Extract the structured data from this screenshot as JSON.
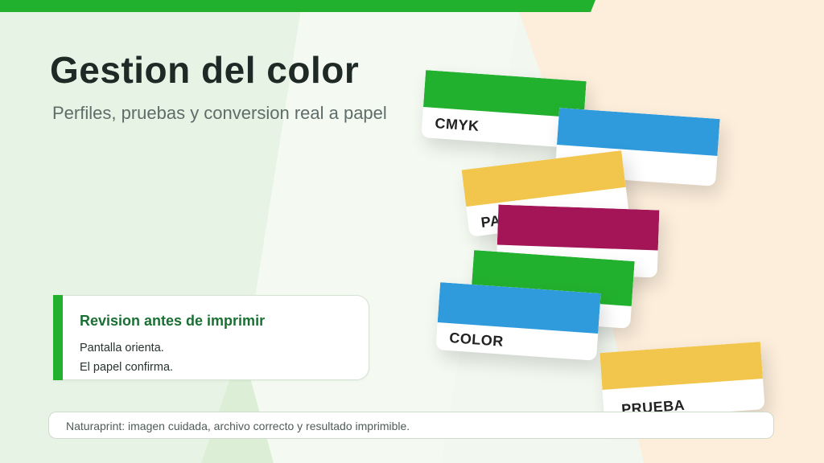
{
  "slide": {
    "title": "Gestion del color",
    "subtitle": "Perfiles, pruebas y conversion real a papel"
  },
  "note": {
    "heading": "Revision antes de imprimir",
    "lines": [
      "Pantalla orienta.",
      "El papel confirma."
    ]
  },
  "cards": [
    {
      "label": "CMYK",
      "band_color": "#22b12e"
    },
    {
      "label": "",
      "band_color": "#2f9bdc"
    },
    {
      "label": "PA",
      "band_color": "#f2c64c"
    },
    {
      "label": "",
      "band_color": "#a31557"
    },
    {
      "label": "",
      "band_color": "#22b12e"
    },
    {
      "label": "COLOR",
      "band_color": "#2f9bdc"
    },
    {
      "label": "PRUEBA",
      "band_color": "#f2c64c"
    }
  ],
  "footer": {
    "text": "Naturaprint: imagen cuidada, archivo correcto y resultado imprimible."
  },
  "colors": {
    "accent": "#22b12e",
    "background": "#f2f8f0",
    "right_panel": "#fdeedb"
  }
}
